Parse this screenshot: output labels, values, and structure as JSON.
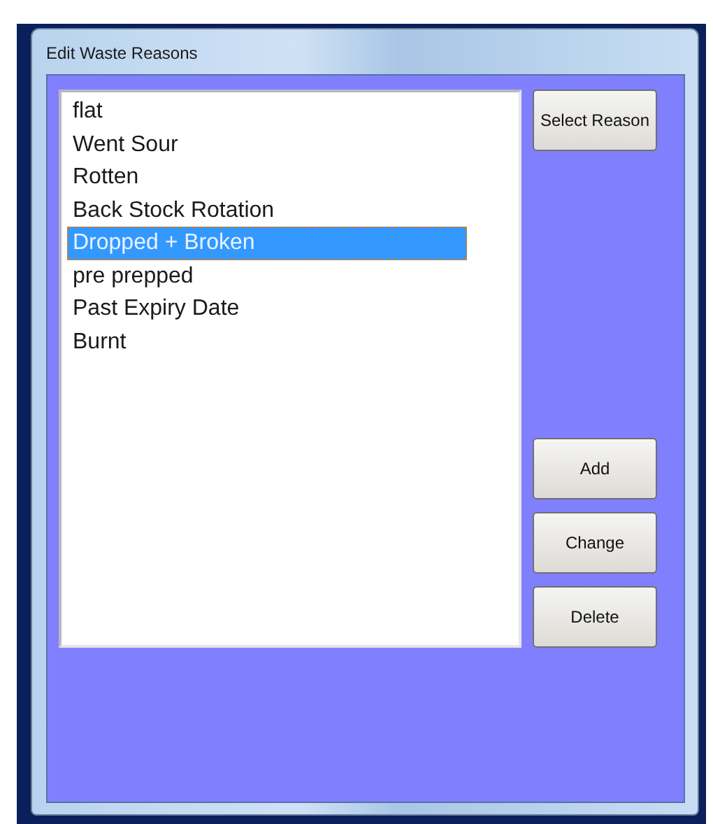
{
  "window": {
    "title": "Edit Waste Reasons"
  },
  "reasons": [
    {
      "label": "flat",
      "selected": false
    },
    {
      "label": "Went Sour",
      "selected": false
    },
    {
      "label": "Rotten",
      "selected": false
    },
    {
      "label": "Back Stock Rotation",
      "selected": false
    },
    {
      "label": "Dropped + Broken",
      "selected": true
    },
    {
      "label": "pre prepped",
      "selected": false
    },
    {
      "label": "Past Expiry Date",
      "selected": false
    },
    {
      "label": "Burnt",
      "selected": false
    }
  ],
  "top_button": "Select Reason",
  "buttons": [
    "Add",
    "Change",
    "Delete"
  ]
}
